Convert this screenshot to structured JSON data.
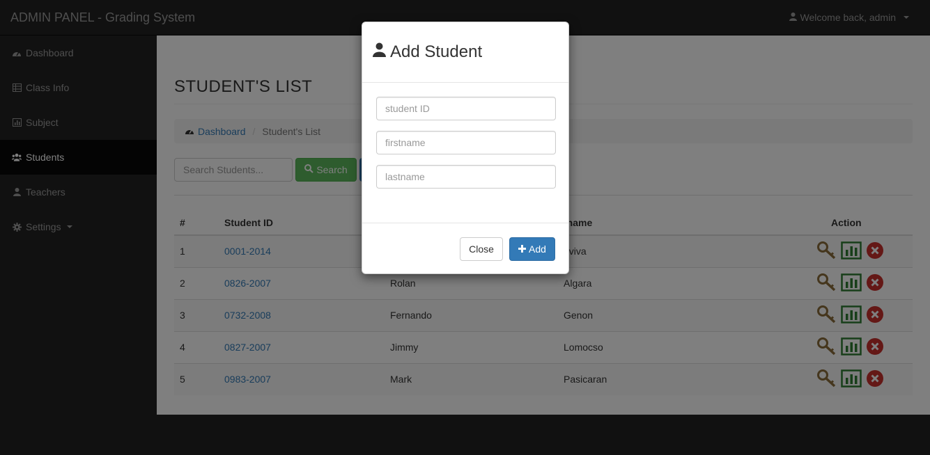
{
  "topbar": {
    "brand": "ADMIN PANEL - Grading System",
    "user_label": "Welcome back, admin"
  },
  "sidebar": {
    "items": [
      {
        "label": "Dashboard",
        "icon": "dashboard-icon"
      },
      {
        "label": "Class Info",
        "icon": "table-icon"
      },
      {
        "label": "Subject",
        "icon": "bar-chart-icon"
      },
      {
        "label": "Students",
        "icon": "users-icon",
        "active": true
      },
      {
        "label": "Teachers",
        "icon": "user-icon"
      },
      {
        "label": "Settings",
        "icon": "gear-icon"
      }
    ]
  },
  "main": {
    "title": "STUDENT'S LIST",
    "breadcrumb": {
      "home": "Dashboard",
      "current": "Student's List"
    },
    "search": {
      "placeholder": "Search Students...",
      "button_label": "Search"
    },
    "table": {
      "headers": {
        "num": "#",
        "student_id": "Student ID",
        "firstname": "",
        "lastname": "tname",
        "action": "Action"
      },
      "rows": [
        {
          "num": "1",
          "student_id": "0001-2014",
          "firstname": "",
          "lastname": "aviva"
        },
        {
          "num": "2",
          "student_id": "0826-2007",
          "firstname": "Rolan",
          "lastname": "Algara"
        },
        {
          "num": "3",
          "student_id": "0732-2008",
          "firstname": "Fernando",
          "lastname": "Genon"
        },
        {
          "num": "4",
          "student_id": "0827-2007",
          "firstname": "Jimmy",
          "lastname": "Lomocso"
        },
        {
          "num": "5",
          "student_id": "0983-2007",
          "firstname": "Mark",
          "lastname": "Pasicaran"
        }
      ]
    }
  },
  "modal": {
    "title": "Add Student",
    "fields": {
      "student_id": {
        "placeholder": "student ID",
        "value": ""
      },
      "firstname": {
        "placeholder": "firstname",
        "value": ""
      },
      "lastname": {
        "placeholder": "lastname",
        "value": ""
      }
    },
    "close_label": "Close",
    "add_label": "Add"
  },
  "colors": {
    "navbar": "#222222",
    "success": "#5cb85c",
    "primary": "#337ab7",
    "key": "#8a6d3b",
    "chart": "#2e7d32",
    "delete": "#c9302c"
  }
}
